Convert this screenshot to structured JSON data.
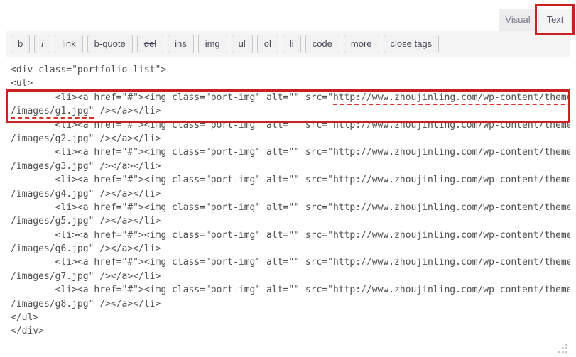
{
  "tabs": [
    {
      "label": "Visual",
      "active": false,
      "name": "tab-visual"
    },
    {
      "label": "Text",
      "active": true,
      "name": "tab-text"
    }
  ],
  "toolbar": {
    "buttons": [
      {
        "label": "b",
        "style": "bold",
        "name": "toolbar-button-bold"
      },
      {
        "label": "i",
        "style": "italic",
        "name": "toolbar-button-italic"
      },
      {
        "label": "link",
        "style": "underline",
        "name": "toolbar-button-link"
      },
      {
        "label": "b-quote",
        "style": "normal",
        "name": "toolbar-button-blockquote"
      },
      {
        "label": "del",
        "style": "strikethrough",
        "name": "toolbar-button-del"
      },
      {
        "label": "ins",
        "style": "normal",
        "name": "toolbar-button-ins"
      },
      {
        "label": "img",
        "style": "normal",
        "name": "toolbar-button-img"
      },
      {
        "label": "ul",
        "style": "normal",
        "name": "toolbar-button-ul"
      },
      {
        "label": "ol",
        "style": "normal",
        "name": "toolbar-button-ol"
      },
      {
        "label": "li",
        "style": "normal",
        "name": "toolbar-button-li"
      },
      {
        "label": "code",
        "style": "normal",
        "name": "toolbar-button-code"
      },
      {
        "label": "more",
        "style": "normal",
        "name": "toolbar-button-more"
      },
      {
        "label": "close tags",
        "style": "normal",
        "name": "toolbar-button-close-tags"
      }
    ]
  },
  "editor": {
    "base_url": "http://www.zhoujinling.com/wp-content/themes/onetone",
    "lines": [
      "<div class=\"portfolio-list\">",
      "<ul>",
      "        <li><a href=\"#\"><img class=\"port-img\" alt=\"\" src=\"http://www.zhoujinling.com/wp-content/themes/onetone",
      "/images/g1.jpg\" /></a></li>",
      "        <li><a href=\"#\"><img class=\"port-img\" alt=\"\" src=\"http://www.zhoujinling.com/wp-content/themes/onetone",
      "/images/g2.jpg\" /></a></li>",
      "        <li><a href=\"#\"><img class=\"port-img\" alt=\"\" src=\"http://www.zhoujinling.com/wp-content/themes/onetone",
      "/images/g3.jpg\" /></a></li>",
      "        <li><a href=\"#\"><img class=\"port-img\" alt=\"\" src=\"http://www.zhoujinling.com/wp-content/themes/onetone",
      "/images/g4.jpg\" /></a></li>",
      "        <li><a href=\"#\"><img class=\"port-img\" alt=\"\" src=\"http://www.zhoujinling.com/wp-content/themes/onetone",
      "/images/g5.jpg\" /></a></li>",
      "        <li><a href=\"#\"><img class=\"port-img\" alt=\"\" src=\"http://www.zhoujinling.com/wp-content/themes/onetone",
      "/images/g6.jpg\" /></a></li>",
      "        <li><a href=\"#\"><img class=\"port-img\" alt=\"\" src=\"http://www.zhoujinling.com/wp-content/themes/onetone",
      "/images/g7.jpg\" /></a></li>",
      "        <li><a href=\"#\"><img class=\"port-img\" alt=\"\" src=\"http://www.zhoujinling.com/wp-content/themes/onetone",
      "/images/g8.jpg\" /></a></li>",
      "</ul>",
      "</div>"
    ],
    "spellcheck_underlined": [
      "http://www.zhoujinling.com/wp-content/themes/onetone",
      "/images/g1.jpg\""
    ]
  },
  "annotations": {
    "color": "#cc1f1f",
    "boxes": [
      {
        "name": "annotation-box-text-tab",
        "target": "Text"
      },
      {
        "name": "annotation-box-first-image-line",
        "target": "/images/g1.jpg"
      }
    ]
  },
  "resize": {
    "name": "resize-grip"
  }
}
